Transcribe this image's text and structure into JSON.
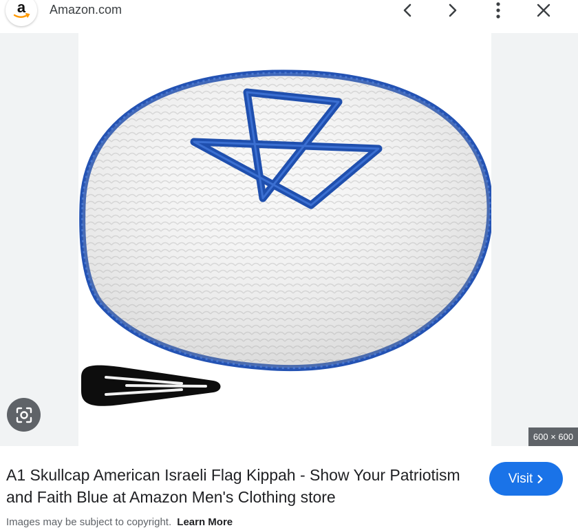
{
  "header": {
    "favicon_letter": "a",
    "site_name": "Amazon.com",
    "icons": [
      "chevron-left-icon",
      "chevron-right-icon",
      "more-vert-icon",
      "close-icon"
    ]
  },
  "image": {
    "dimensions": "600 × 600",
    "subject": "white crocheted kippah with blue Star of David and blue trim, black hair clip",
    "lens_icon": "google-lens-icon"
  },
  "result": {
    "title": "A1 Skullcap American Israeli Flag Kippah - Show Your Patriotism and Faith Blue at Amazon Men's Clothing store",
    "visit_label": "Visit",
    "copyright_note": "Images may be subject to copyright.",
    "learn_more": "Learn More"
  },
  "colors": {
    "accent": "#1a73e8",
    "kippah_blue": "#1f4fae",
    "amazon_orange": "#ff9900",
    "overlay_grey": "#5f6368"
  }
}
